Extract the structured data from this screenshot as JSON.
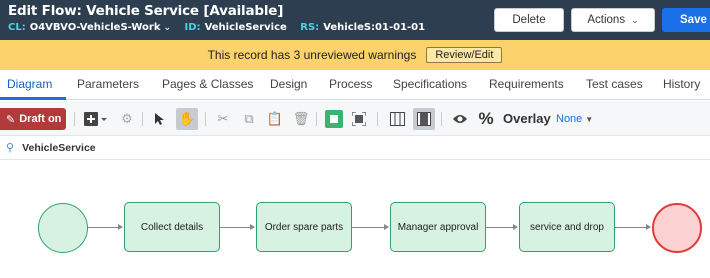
{
  "header": {
    "title": "Edit  Flow: Vehicle Service [Available]",
    "cl_label": "CL:",
    "cl_value": "O4VBVO-VehicleS-Work",
    "id_label": "ID:",
    "id_value": "VehicleService",
    "rs_label": "RS:",
    "rs_value": "VehicleS:01-01-01",
    "delete_label": "Delete",
    "actions_label": "Actions",
    "save_label": "Save"
  },
  "banner": {
    "message": "This record has 3 unreviewed warnings",
    "review_label": "Review/Edit"
  },
  "tabs": [
    "Diagram",
    "Parameters",
    "Pages & Classes",
    "Design",
    "Process",
    "Specifications",
    "Requirements",
    "Test cases",
    "History"
  ],
  "toolbar": {
    "draft_label": "Draft on",
    "overlay_label": "Overlay",
    "overlay_value": "None"
  },
  "breadcrumb": {
    "label": "VehicleService"
  },
  "flow": {
    "steps": [
      "Collect details",
      "Order spare parts",
      "Manager approval",
      "service and drop"
    ],
    "colors": {
      "step_border": "#2fa36b",
      "step_fill": "#d7f2e2",
      "end_border": "#e23a3a",
      "end_fill": "#fbd1d1"
    }
  }
}
